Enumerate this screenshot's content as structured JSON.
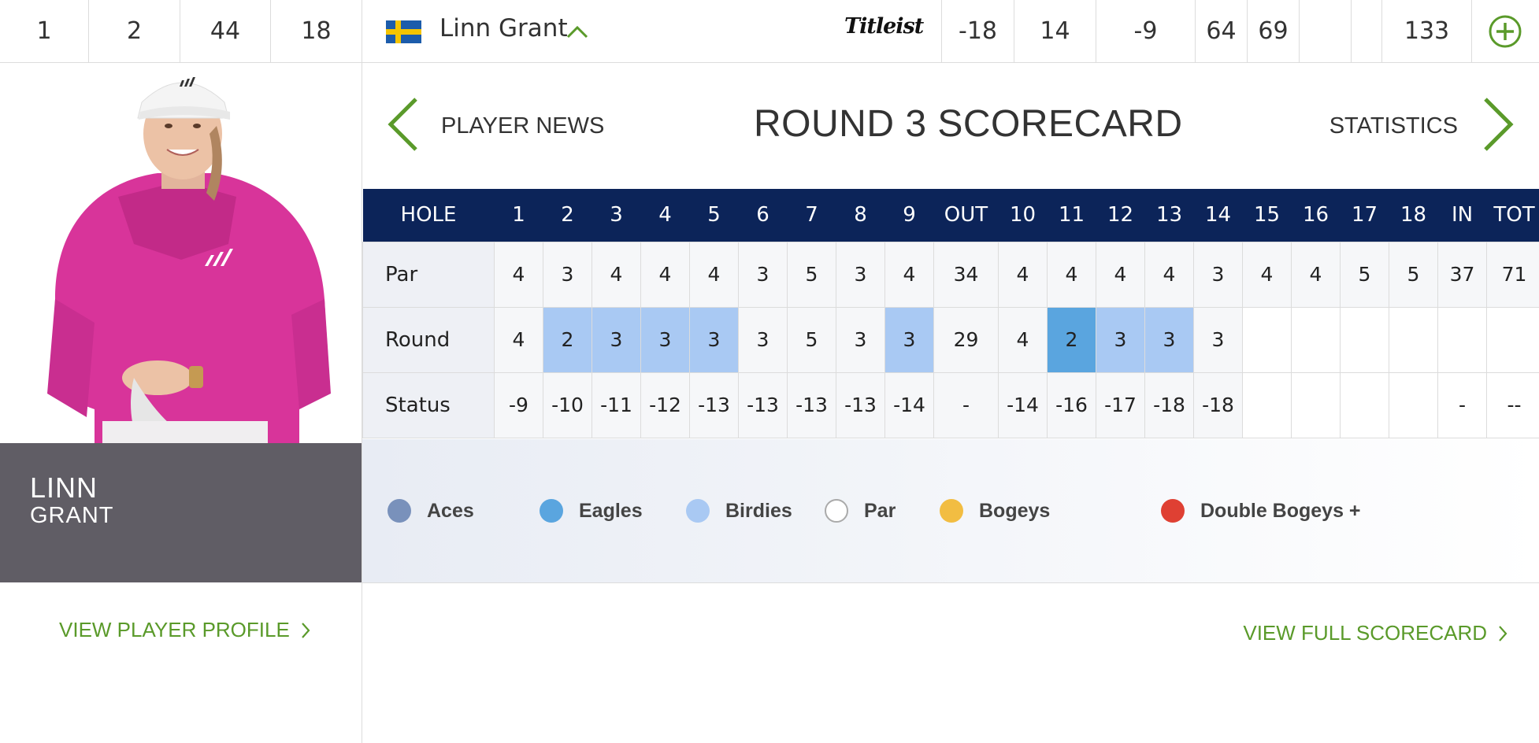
{
  "leaderboard": {
    "position": "1",
    "col2": "2",
    "col3": "44",
    "col4": "18",
    "player_name": "Linn Grant",
    "sponsor": "Titleist",
    "to_par": "-18",
    "thru": "14",
    "today": "-9",
    "r1": "64",
    "r2": "69",
    "r3": "",
    "r4": "",
    "total": "133"
  },
  "player": {
    "first_name": "LINN",
    "last_name": "GRANT",
    "profile_link": "VIEW PLAYER PROFILE"
  },
  "header": {
    "title": "ROUND 3 SCORECARD",
    "prev_label": "PLAYER NEWS",
    "next_label": "STATISTICS"
  },
  "scorecard": {
    "columns": [
      "HOLE",
      "1",
      "2",
      "3",
      "4",
      "5",
      "6",
      "7",
      "8",
      "9",
      "OUT",
      "10",
      "11",
      "12",
      "13",
      "14",
      "15",
      "16",
      "17",
      "18",
      "IN",
      "TOT"
    ],
    "rows": [
      {
        "label": "Par",
        "cells": [
          {
            "v": "4",
            "k": ""
          },
          {
            "v": "3",
            "k": ""
          },
          {
            "v": "4",
            "k": ""
          },
          {
            "v": "4",
            "k": ""
          },
          {
            "v": "4",
            "k": ""
          },
          {
            "v": "3",
            "k": ""
          },
          {
            "v": "5",
            "k": ""
          },
          {
            "v": "3",
            "k": ""
          },
          {
            "v": "4",
            "k": ""
          },
          {
            "v": "34",
            "k": ""
          },
          {
            "v": "4",
            "k": ""
          },
          {
            "v": "4",
            "k": ""
          },
          {
            "v": "4",
            "k": ""
          },
          {
            "v": "4",
            "k": ""
          },
          {
            "v": "3",
            "k": ""
          },
          {
            "v": "4",
            "k": ""
          },
          {
            "v": "4",
            "k": ""
          },
          {
            "v": "5",
            "k": ""
          },
          {
            "v": "5",
            "k": ""
          },
          {
            "v": "37",
            "k": ""
          },
          {
            "v": "71",
            "k": ""
          }
        ]
      },
      {
        "label": "Round",
        "cells": [
          {
            "v": "4",
            "k": ""
          },
          {
            "v": "2",
            "k": "birdie"
          },
          {
            "v": "3",
            "k": "birdie"
          },
          {
            "v": "3",
            "k": "birdie"
          },
          {
            "v": "3",
            "k": "birdie"
          },
          {
            "v": "3",
            "k": ""
          },
          {
            "v": "5",
            "k": ""
          },
          {
            "v": "3",
            "k": ""
          },
          {
            "v": "3",
            "k": "birdie"
          },
          {
            "v": "29",
            "k": ""
          },
          {
            "v": "4",
            "k": ""
          },
          {
            "v": "2",
            "k": "eagle"
          },
          {
            "v": "3",
            "k": "birdie"
          },
          {
            "v": "3",
            "k": "birdie"
          },
          {
            "v": "3",
            "k": ""
          },
          {
            "v": "",
            "k": "blank"
          },
          {
            "v": "",
            "k": "blank"
          },
          {
            "v": "",
            "k": "blank"
          },
          {
            "v": "",
            "k": "blank"
          },
          {
            "v": "",
            "k": "blank"
          },
          {
            "v": "",
            "k": "blank"
          }
        ]
      },
      {
        "label": "Status",
        "cells": [
          {
            "v": "-9",
            "k": ""
          },
          {
            "v": "-10",
            "k": ""
          },
          {
            "v": "-11",
            "k": ""
          },
          {
            "v": "-12",
            "k": ""
          },
          {
            "v": "-13",
            "k": ""
          },
          {
            "v": "-13",
            "k": ""
          },
          {
            "v": "-13",
            "k": ""
          },
          {
            "v": "-13",
            "k": ""
          },
          {
            "v": "-14",
            "k": ""
          },
          {
            "v": "-",
            "k": ""
          },
          {
            "v": "-14",
            "k": ""
          },
          {
            "v": "-16",
            "k": ""
          },
          {
            "v": "-17",
            "k": ""
          },
          {
            "v": "-18",
            "k": ""
          },
          {
            "v": "-18",
            "k": ""
          },
          {
            "v": "",
            "k": "blank"
          },
          {
            "v": "",
            "k": "blank"
          },
          {
            "v": "",
            "k": "blank"
          },
          {
            "v": "",
            "k": "blank"
          },
          {
            "v": "-",
            "k": "blank"
          },
          {
            "v": "--",
            "k": "blank"
          }
        ]
      }
    ]
  },
  "legend": [
    {
      "label": "Aces",
      "color": "#7991bb"
    },
    {
      "label": "Eagles",
      "color": "#5aa5df"
    },
    {
      "label": "Birdies",
      "color": "#a9c9f3"
    },
    {
      "label": "Par",
      "color": "#ffffff"
    },
    {
      "label": "Bogeys",
      "color": "#f2bd42"
    },
    {
      "label": "Double Bogeys +",
      "color": "#df4033"
    }
  ],
  "links": {
    "full_scorecard": "VIEW FULL SCORECARD"
  },
  "colors": {
    "accent_green": "#5a9a2a",
    "header_navy": "#0c2459",
    "name_box": "#605d65"
  },
  "icons": {
    "flag": "sweden-flag-icon",
    "expand": "chevron-up-icon",
    "add": "plus-circle-icon",
    "prev": "chevron-left-icon",
    "next": "chevron-right-icon"
  }
}
